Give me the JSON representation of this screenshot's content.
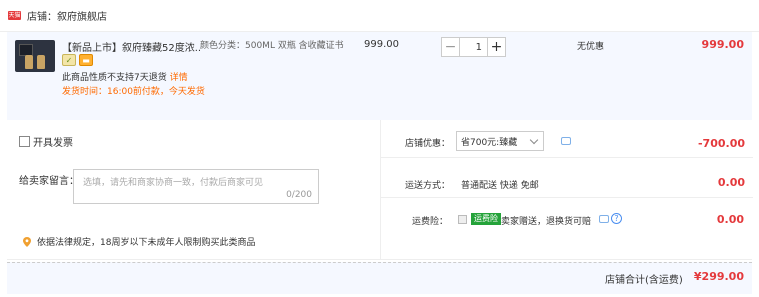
{
  "shop": {
    "tag": "天猫",
    "label": "店铺：叙府旗舰店"
  },
  "item": {
    "title": "【新品上市】叙府臻藏52度浓...",
    "notice": "此商品性质不支持7天退货",
    "notice_link": "详情",
    "ship_time": "发货时间：16:00前付款，今天发货",
    "spec": "颜色分类：500ML 双瓶 含收藏证书",
    "unit_price": "999.00",
    "quantity": "1",
    "qty_minus": "−",
    "qty_plus": "+",
    "discount": "无优惠",
    "total": "999.00"
  },
  "invoice": {
    "label": "开具发票"
  },
  "message": {
    "label": "给卖家留言：",
    "placeholder": "选填，请先和商家协商一致，付款后商家可见",
    "count": "0/200"
  },
  "law_notice": "依据法律规定，18周岁以下未成年人限制购买此类商品",
  "shop_coupon": {
    "label": "店铺优惠：",
    "selected": "省700元:臻藏",
    "amount": "-700.00"
  },
  "shipping": {
    "label": "运送方式：",
    "value": "普通配送 快递 免邮",
    "amount": "0.00"
  },
  "insurance": {
    "label": "运费险：",
    "tag": "运费险",
    "text": "卖家赠送，退换货可赔",
    "amount": "0.00"
  },
  "footer": {
    "label": "店铺合计(含运费)",
    "amount": "¥299.00"
  },
  "colors": {
    "accent_red": "#e4393c",
    "accent_orange": "#ff6a00",
    "row_bg": "#f5f8ff"
  }
}
